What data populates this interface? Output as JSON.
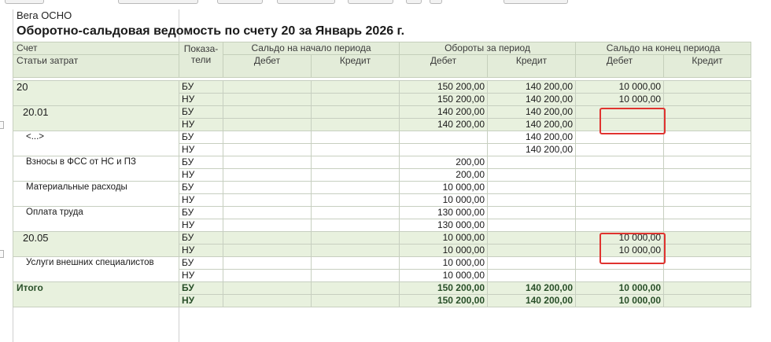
{
  "report": {
    "org_name": "Вега ОСНО",
    "title": "Оборотно-сальдовая ведомость по счету 20 за Январь 2026 г."
  },
  "headers": {
    "account": "Счет",
    "cost_items": "Статьи затрат",
    "indicators_line1": "Показа-",
    "indicators_line2": "тели",
    "opening": "Сальдо на начало периода",
    "turnover": "Обороты за период",
    "closing": "Сальдо на конец периода",
    "debit": "Дебет",
    "credit": "Кредит"
  },
  "rows": [
    {
      "name": "20",
      "level": 0,
      "lines": [
        {
          "ind": "БУ",
          "turn_debit": "150 200,00",
          "turn_credit": "140 200,00",
          "close_debit": "10 000,00"
        },
        {
          "ind": "НУ",
          "turn_debit": "150 200,00",
          "turn_credit": "140 200,00",
          "close_debit": "10 000,00"
        }
      ]
    },
    {
      "name": "20.01",
      "level": 1,
      "lines": [
        {
          "ind": "БУ",
          "turn_debit": "140 200,00",
          "turn_credit": "140 200,00",
          "close_debit": ""
        },
        {
          "ind": "НУ",
          "turn_debit": "140 200,00",
          "turn_credit": "140 200,00",
          "close_debit": ""
        }
      ]
    },
    {
      "name": "<...>",
      "level": 2,
      "lines": [
        {
          "ind": "БУ",
          "turn_debit": "",
          "turn_credit": "140 200,00",
          "close_debit": ""
        },
        {
          "ind": "НУ",
          "turn_debit": "",
          "turn_credit": "140 200,00",
          "close_debit": ""
        }
      ]
    },
    {
      "name": "Взносы в ФСС от НС и ПЗ",
      "level": 2,
      "lines": [
        {
          "ind": "БУ",
          "turn_debit": "200,00",
          "turn_credit": "",
          "close_debit": ""
        },
        {
          "ind": "НУ",
          "turn_debit": "200,00",
          "turn_credit": "",
          "close_debit": ""
        }
      ]
    },
    {
      "name": "Материальные расходы",
      "level": 2,
      "lines": [
        {
          "ind": "БУ",
          "turn_debit": "10 000,00",
          "turn_credit": "",
          "close_debit": ""
        },
        {
          "ind": "НУ",
          "turn_debit": "10 000,00",
          "turn_credit": "",
          "close_debit": ""
        }
      ]
    },
    {
      "name": "Оплата труда",
      "level": 2,
      "lines": [
        {
          "ind": "БУ",
          "turn_debit": "130 000,00",
          "turn_credit": "",
          "close_debit": ""
        },
        {
          "ind": "НУ",
          "turn_debit": "130 000,00",
          "turn_credit": "",
          "close_debit": ""
        }
      ]
    },
    {
      "name": "20.05",
      "level": 1,
      "lines": [
        {
          "ind": "БУ",
          "turn_debit": "10 000,00",
          "turn_credit": "",
          "close_debit": "10 000,00"
        },
        {
          "ind": "НУ",
          "turn_debit": "10 000,00",
          "turn_credit": "",
          "close_debit": "10 000,00"
        }
      ]
    },
    {
      "name": "Услуги внешних специалистов",
      "level": 2,
      "lines": [
        {
          "ind": "БУ",
          "turn_debit": "10 000,00",
          "turn_credit": "",
          "close_debit": ""
        },
        {
          "ind": "НУ",
          "turn_debit": "10 000,00",
          "turn_credit": "",
          "close_debit": ""
        }
      ]
    },
    {
      "name": "Итого",
      "level": "total",
      "lines": [
        {
          "ind": "БУ",
          "turn_debit": "150 200,00",
          "turn_credit": "140 200,00",
          "close_debit": "10 000,00"
        },
        {
          "ind": "НУ",
          "turn_debit": "150 200,00",
          "turn_credit": "140 200,00",
          "close_debit": "10 000,00"
        }
      ]
    }
  ],
  "colors": {
    "header_bg": "#e3ecd9",
    "group_row_bg": "#e8f1de",
    "total_text": "#294f29",
    "callout_border": "#e0332f"
  }
}
